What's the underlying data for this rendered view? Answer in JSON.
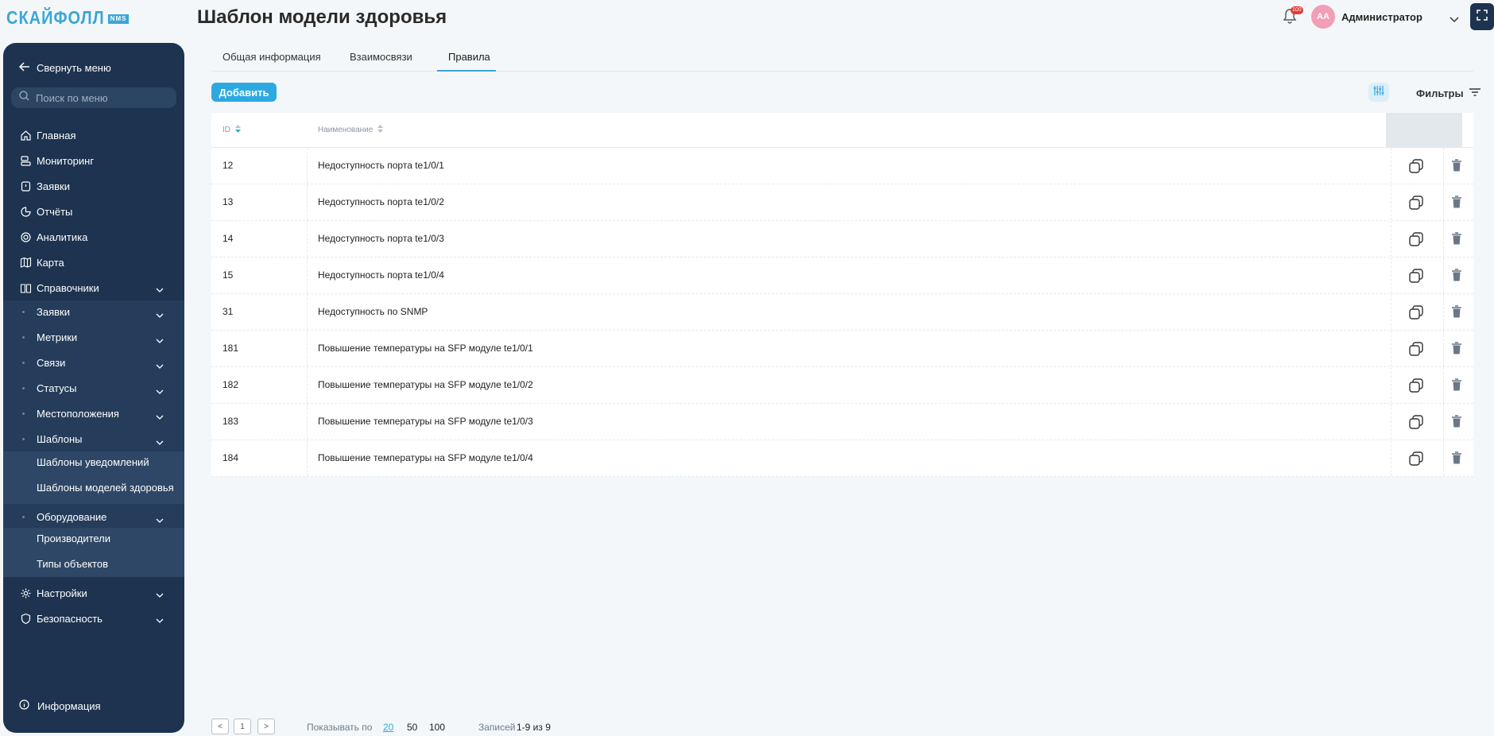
{
  "logo": {
    "text": "СКАЙФОЛЛ",
    "badge": "NMS"
  },
  "sidebar": {
    "collapse_label": "Свернуть меню",
    "search_placeholder": "Поиск по меню",
    "items": [
      {
        "label": "Главная",
        "icon": "home-icon"
      },
      {
        "label": "Мониторинг",
        "icon": "monitoring-icon"
      },
      {
        "label": "Заявки",
        "icon": "requests-icon"
      },
      {
        "label": "Отчёты",
        "icon": "reports-icon"
      },
      {
        "label": "Аналитика",
        "icon": "analytics-icon"
      },
      {
        "label": "Карта",
        "icon": "map-icon"
      },
      {
        "label": "Справочники",
        "icon": "book-icon"
      }
    ],
    "sub_items": [
      {
        "label": "Заявки"
      },
      {
        "label": "Метрики"
      },
      {
        "label": "Связи"
      },
      {
        "label": "Статусы"
      },
      {
        "label": "Местоположения"
      },
      {
        "label": "Шаблоны"
      }
    ],
    "templates_leaves": [
      "Шаблоны уведомлений",
      "Шаблоны моделей здоровья"
    ],
    "equipment_label": "Оборудование",
    "equipment_leaves": [
      "Производители",
      "Типы объектов"
    ],
    "bottom_items": [
      {
        "label": "Настройки",
        "icon": "gear-icon"
      },
      {
        "label": "Безопасность",
        "icon": "shield-icon"
      }
    ],
    "info_label": "Информация"
  },
  "header": {
    "title": "Шаблон модели здоровья",
    "notification_count": "100",
    "avatar_initials": "АА",
    "username": "Администратор"
  },
  "tabs": [
    {
      "label": "Общая информация",
      "active": false
    },
    {
      "label": "Взаимосвязи",
      "active": false
    },
    {
      "label": "Правила",
      "active": true
    }
  ],
  "toolbar": {
    "add_label": "Добавить",
    "filters_label": "Фильтры"
  },
  "table": {
    "columns": [
      "ID",
      "Наименование"
    ],
    "rows": [
      {
        "id": "12",
        "name": "Недоступность порта te1/0/1"
      },
      {
        "id": "13",
        "name": "Недоступность порта te1/0/2"
      },
      {
        "id": "14",
        "name": "Недоступность порта te1/0/3"
      },
      {
        "id": "15",
        "name": "Недоступность порта te1/0/4"
      },
      {
        "id": "31",
        "name": "Недоступность по SNMP"
      },
      {
        "id": "181",
        "name": "Повышение температуры на SFP модуле te1/0/1"
      },
      {
        "id": "182",
        "name": "Повышение температуры на SFP модуле te1/0/2"
      },
      {
        "id": "183",
        "name": "Повышение температуры на SFP модуле te1/0/3"
      },
      {
        "id": "184",
        "name": "Повышение температуры на SFP модуле te1/0/4"
      }
    ]
  },
  "pagination": {
    "prev": "<",
    "current_page": "1",
    "next": ">",
    "show_by_label": "Показывать по",
    "page_sizes": [
      "20",
      "50",
      "100"
    ],
    "active_size": "20",
    "records_label": "Записей",
    "records_value": "1-9 из 9"
  },
  "colors": {
    "sidebar_bg": "#1d3350",
    "accent": "#2da9e1",
    "avatar": "#f29eb6",
    "badge": "#e53935"
  }
}
